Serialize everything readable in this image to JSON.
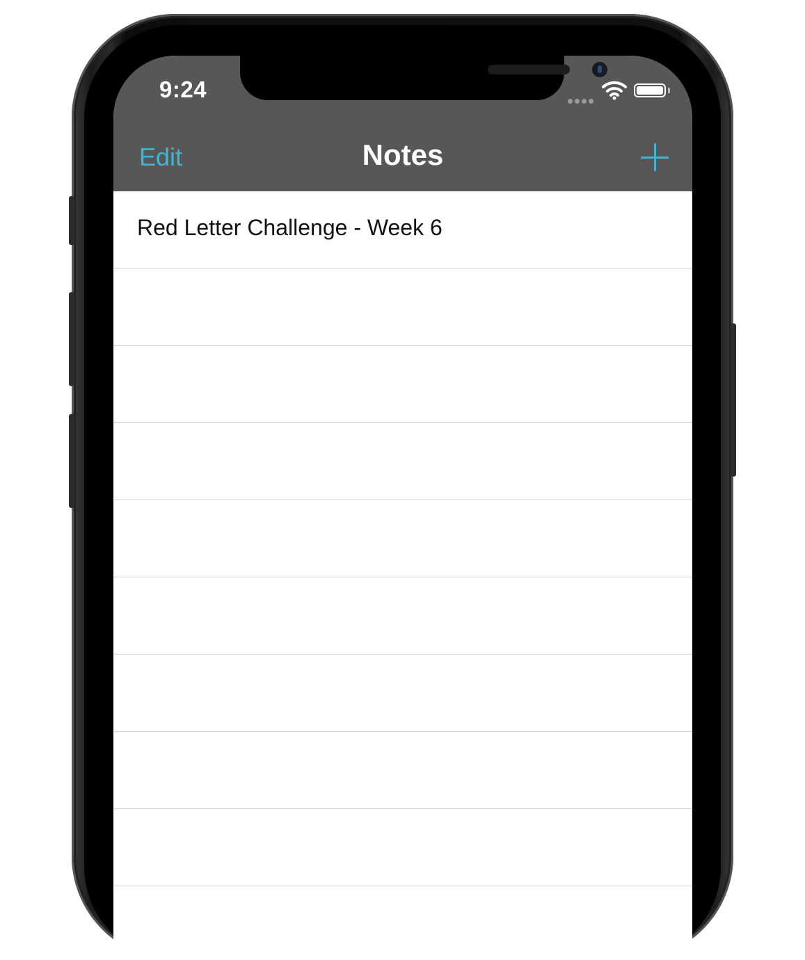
{
  "status_bar": {
    "time": "9:24"
  },
  "nav_bar": {
    "edit_label": "Edit",
    "title": "Notes",
    "add_icon": "plus-icon"
  },
  "notes": [
    {
      "title": "Red Letter Challenge - Week 6"
    },
    {
      "title": ""
    },
    {
      "title": ""
    },
    {
      "title": ""
    },
    {
      "title": ""
    },
    {
      "title": ""
    },
    {
      "title": ""
    },
    {
      "title": ""
    },
    {
      "title": ""
    },
    {
      "title": ""
    }
  ],
  "colors": {
    "accent": "#3fb4d3",
    "header": "#575757"
  }
}
